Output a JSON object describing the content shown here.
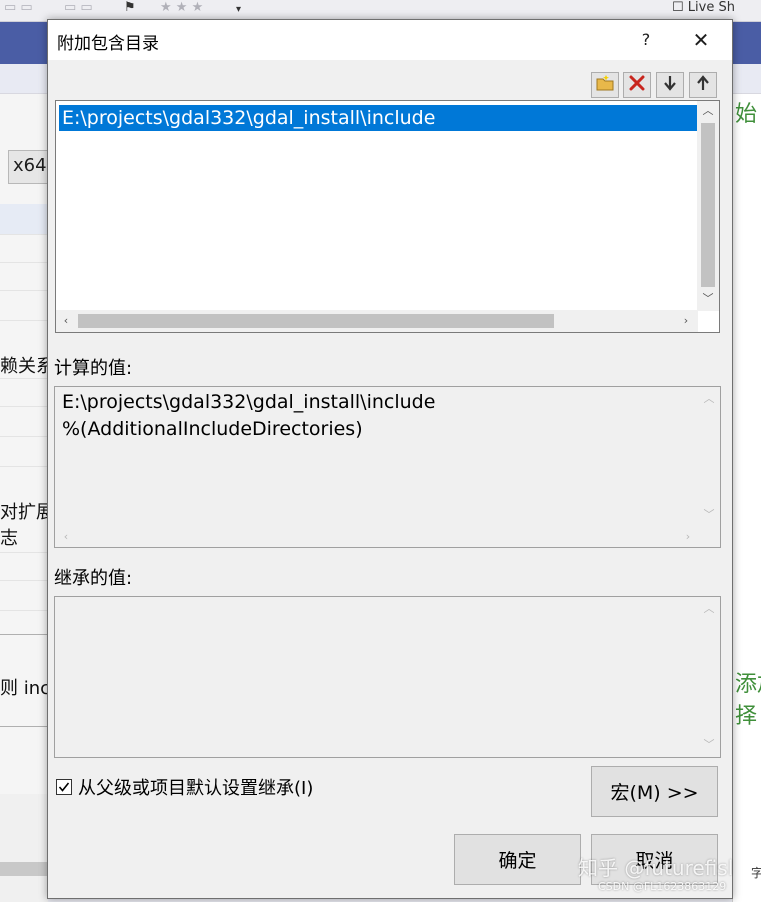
{
  "background": {
    "toolbar_right_text": "Live Sh",
    "left_panel": {
      "combo_value": "x64",
      "texts": [
        "赖关系",
        "对扩展",
        "志",
        "则 incl"
      ]
    },
    "right_panel": {
      "texts": [
        "始",
        "添加",
        "择 ."
      ]
    },
    "right_edge_char": "字"
  },
  "dialog": {
    "title": "附加包含目录",
    "help": "?",
    "close": "✕",
    "toolbar": {
      "new_line": "new-line-icon",
      "delete": "delete-icon",
      "move_down": "arrow-down-icon",
      "move_up": "arrow-up-icon"
    },
    "list": {
      "items": [
        "E:\\projects\\gdal332\\gdal_install\\include"
      ]
    },
    "computed": {
      "label": "计算的值:",
      "lines": [
        "E:\\projects\\gdal332\\gdal_install\\include",
        "%(AdditionalIncludeDirectories)"
      ]
    },
    "inherited": {
      "label": "继承的值:"
    },
    "inherit_checkbox": {
      "label": "从父级或项目默认设置继承(I)",
      "checked": true
    },
    "buttons": {
      "macros": "宏(M) >>",
      "ok": "确定",
      "cancel": "取消"
    }
  },
  "watermark": {
    "main": "知乎 @futurefisl",
    "sub": "CSDN @FL1623863129"
  },
  "colors": {
    "selection": "#0078d7",
    "vs_blue": "#4a5da5",
    "comment_green": "#3f8f3a"
  }
}
